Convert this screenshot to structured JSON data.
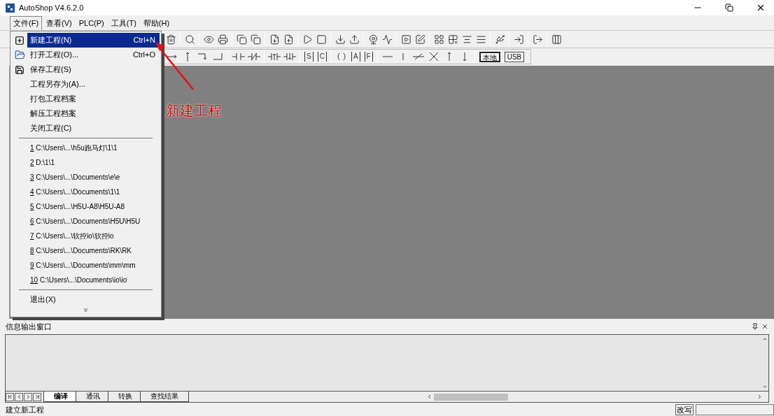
{
  "window": {
    "title": "AutoShop V4.6.2.0"
  },
  "menubar": [
    {
      "label": "文件(F)",
      "selected": true
    },
    {
      "label": "查看(V)",
      "selected": false
    },
    {
      "label": "PLC(P)",
      "selected": false
    },
    {
      "label": "工具(T)",
      "selected": false
    },
    {
      "label": "帮助(H)",
      "selected": false
    }
  ],
  "file_menu": [
    {
      "kind": "command",
      "label": "新建工程(N)",
      "shortcut": "Ctrl+N",
      "selected": true
    },
    {
      "kind": "command",
      "label": "打开工程(O)...",
      "shortcut": "Ctrl+O",
      "selected": false
    },
    {
      "kind": "command",
      "label": "保存工程(S)",
      "selected": false
    },
    {
      "kind": "command",
      "label": "工程另存为(A)...",
      "selected": false
    },
    {
      "kind": "command",
      "label": "打包工程档案",
      "selected": false
    },
    {
      "kind": "command",
      "label": "解压工程档案",
      "selected": false
    },
    {
      "kind": "command",
      "label": "关闭工程(C)",
      "selected": false
    },
    {
      "kind": "separator"
    },
    {
      "kind": "recent",
      "number": "1",
      "path": "C:\\Users\\...\\h5u跑马灯\\1\\1",
      "selected": false
    },
    {
      "kind": "recent",
      "number": "2",
      "path": "D:\\1\\1",
      "selected": false
    },
    {
      "kind": "recent",
      "number": "3",
      "path": "C:\\Users\\...\\Documents\\e\\e",
      "selected": false
    },
    {
      "kind": "recent",
      "number": "4",
      "path": "C:\\Users\\...\\Documents\\1\\1",
      "selected": false
    },
    {
      "kind": "recent",
      "number": "5",
      "path": "C:\\Users\\...\\H5U-A8\\H5U-A8",
      "selected": false
    },
    {
      "kind": "recent",
      "number": "6",
      "path": "C:\\Users\\...\\Documents\\H5U\\H5U",
      "selected": false
    },
    {
      "kind": "recent",
      "number": "7",
      "path": "C:\\Users\\...\\软控io\\软控io",
      "selected": false
    },
    {
      "kind": "recent",
      "number": "8",
      "path": "C:\\Users\\...\\Documents\\RK\\RK",
      "selected": false
    },
    {
      "kind": "recent",
      "number": "9",
      "path": "C:\\Users\\...\\Documents\\mm\\mm",
      "selected": false
    },
    {
      "kind": "recent",
      "number": "10",
      "path": "C:\\Users\\...\\Documents\\io\\io",
      "selected": false
    },
    {
      "kind": "separator"
    },
    {
      "kind": "command",
      "label": "退出(X)",
      "selected": false
    },
    {
      "kind": "more"
    }
  ],
  "ladder_toolbar": {
    "letter_buttons": [
      "S",
      "C",
      "A",
      "F"
    ],
    "connection_buttons": [
      "本地",
      "USB"
    ]
  },
  "annotation": {
    "label": "新建工程"
  },
  "output_panel": {
    "title": "信息输出窗口",
    "tabs": [
      {
        "label": "编译",
        "selected": true
      },
      {
        "label": "通讯",
        "selected": false
      },
      {
        "label": "转换",
        "selected": false
      },
      {
        "label": "查找结果",
        "selected": false
      }
    ]
  },
  "status_bar": {
    "message": "建立新工程",
    "mode": "改写"
  }
}
